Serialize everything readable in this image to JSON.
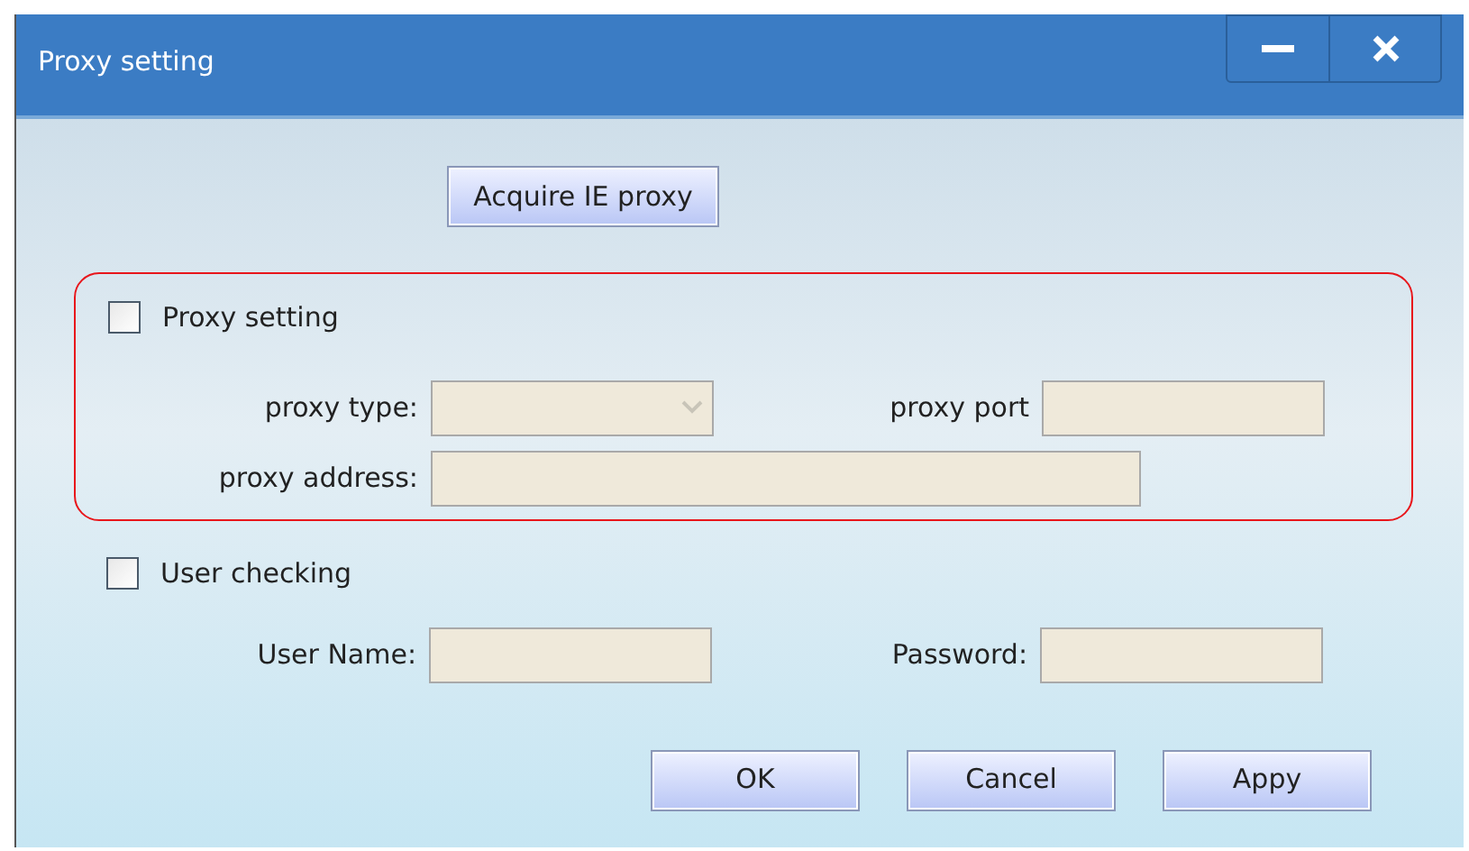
{
  "window": {
    "title": "Proxy setting",
    "controls": [
      {
        "kind": "minimize"
      },
      {
        "kind": "close"
      }
    ]
  },
  "acquire_button": "Acquire IE proxy",
  "proxy_section": {
    "checkbox": {
      "label": "Proxy setting",
      "checked": false
    },
    "proxy_type": {
      "label": "proxy type:",
      "disabled": true
    },
    "proxy_port": {
      "label": "proxy port",
      "disabled": true
    },
    "proxy_address": {
      "label": "proxy address:",
      "disabled": true
    }
  },
  "user_section": {
    "checkbox": {
      "label": "User checking",
      "checked": false
    },
    "user_name": {
      "label": "User Name:",
      "disabled": true
    },
    "password": {
      "label": "Password:",
      "disabled": true
    }
  },
  "buttons": [
    "OK",
    "Cancel",
    "Appy"
  ]
}
